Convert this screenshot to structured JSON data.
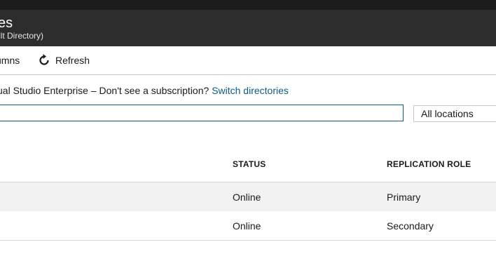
{
  "window": {
    "title": "es",
    "subtitle": "ult Directory)"
  },
  "toolbar": {
    "columns_label": "umns",
    "refresh_label": "Refresh",
    "refresh_icon": "refresh-icon"
  },
  "subscription_info": {
    "text": "ual Studio Enterprise – Don't see a subscription? ",
    "link": "Switch directories"
  },
  "filters": {
    "search_value": "",
    "location_value": "All locations"
  },
  "table": {
    "headers": {
      "status": "STATUS",
      "replication_role": "REPLICATION ROLE"
    },
    "rows": [
      {
        "status": "Online",
        "replication_role": "Primary"
      },
      {
        "status": "Online",
        "replication_role": "Secondary"
      }
    ]
  },
  "colors": {
    "header_bg": "#2d2d2d",
    "topbar_bg": "#1c1c1c",
    "link": "#0e5a8a",
    "selected_row": "#f2f2f2"
  }
}
